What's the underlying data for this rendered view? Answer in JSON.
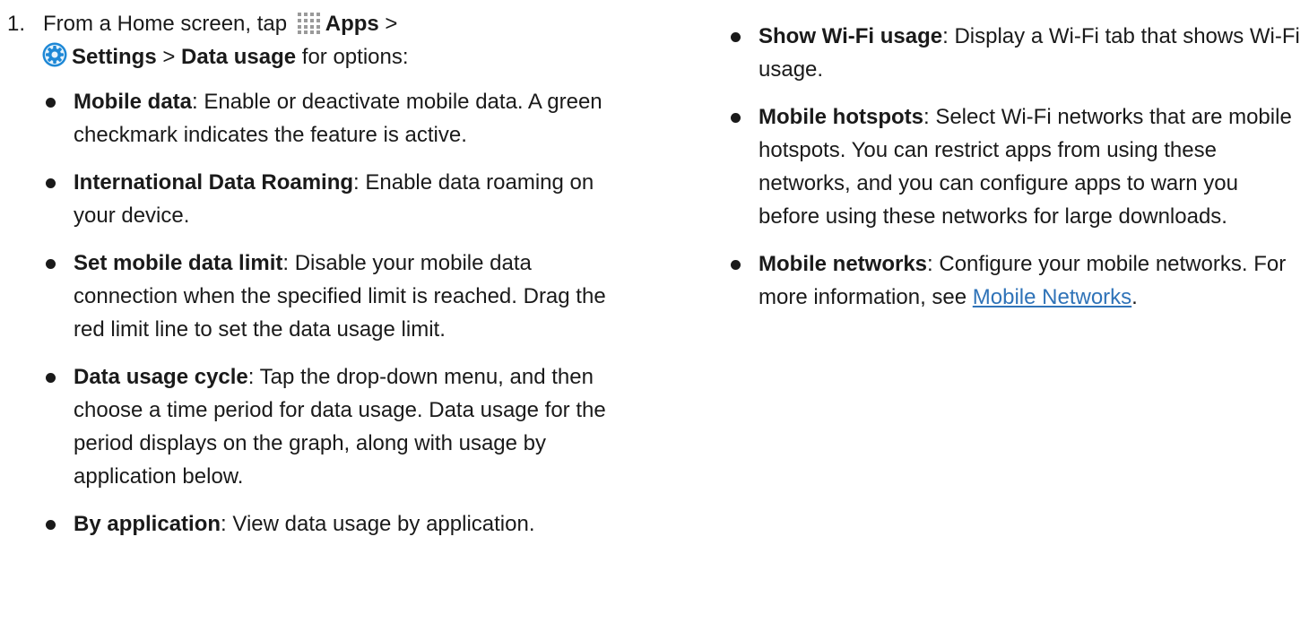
{
  "step": {
    "number": "1.",
    "intro_1": "From a Home screen, tap ",
    "apps_label": "Apps",
    "sep_1": " >",
    "settings_label": "Settings",
    "sep_2": " > ",
    "data_usage_label": "Data usage",
    "intro_end": " for options:"
  },
  "left_items": [
    {
      "term": "Mobile data",
      "desc": ": Enable or deactivate mobile data. A green checkmark indicates the feature is active."
    },
    {
      "term": "International Data Roaming",
      "desc": ": Enable data roaming on your device."
    },
    {
      "term": "Set mobile data limit",
      "desc": ": Disable your mobile data connection when the specified limit is reached. Drag the red limit line to set the data usage limit."
    },
    {
      "term": "Data usage cycle",
      "desc": ": Tap the drop-down menu, and then choose a time period for data usage. Data usage for the period displays on the graph, along with usage by application below."
    },
    {
      "term": "By application",
      "desc": ": View data usage by application."
    }
  ],
  "right_items": [
    {
      "term": "Show Wi-Fi usage",
      "desc": ": Display a Wi-Fi tab that shows Wi-Fi usage."
    },
    {
      "term": "Mobile hotspots",
      "desc": ": Select Wi-Fi networks that are mobile hotspots. You can restrict apps from using these networks, and you can configure apps to warn you before using these networks for large downloads."
    },
    {
      "term": "Mobile networks",
      "desc": ": Configure your mobile networks. For more information, see ",
      "link": "Mobile Networks",
      "after": "."
    }
  ],
  "icons": {
    "apps": "apps-grid-icon",
    "settings": "settings-gear-icon"
  },
  "colors": {
    "text": "#1a1a1a",
    "link": "#2f73b8",
    "settings_icon": "#1e88d6"
  }
}
